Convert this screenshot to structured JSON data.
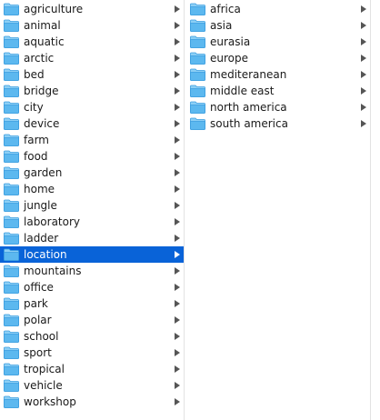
{
  "columns": [
    {
      "items": [
        {
          "label": "agriculture"
        },
        {
          "label": "animal"
        },
        {
          "label": "aquatic"
        },
        {
          "label": "arctic"
        },
        {
          "label": "bed"
        },
        {
          "label": "bridge"
        },
        {
          "label": "city"
        },
        {
          "label": "device"
        },
        {
          "label": "farm"
        },
        {
          "label": "food"
        },
        {
          "label": "garden"
        },
        {
          "label": "home"
        },
        {
          "label": "jungle"
        },
        {
          "label": "laboratory"
        },
        {
          "label": "ladder"
        },
        {
          "label": "location",
          "selected": true
        },
        {
          "label": "mountains"
        },
        {
          "label": "office"
        },
        {
          "label": "park"
        },
        {
          "label": "polar"
        },
        {
          "label": "school"
        },
        {
          "label": "sport"
        },
        {
          "label": "tropical"
        },
        {
          "label": "vehicle"
        },
        {
          "label": "workshop"
        }
      ]
    },
    {
      "items": [
        {
          "label": "africa"
        },
        {
          "label": "asia"
        },
        {
          "label": "eurasia"
        },
        {
          "label": "europe"
        },
        {
          "label": "mediteranean"
        },
        {
          "label": "middle east"
        },
        {
          "label": "north america"
        },
        {
          "label": "south america"
        }
      ]
    }
  ],
  "icons": {
    "folder": "folder-icon",
    "disclosure": "chevron-right-icon"
  },
  "colors": {
    "folder_body": "#5cb8ef",
    "folder_tab": "#8ccff5",
    "folder_edge": "#3a9de0",
    "chevron": "#555555",
    "chevron_selected": "#ffffff",
    "selection": "#0963d8",
    "separator": "#e2e2e2"
  }
}
